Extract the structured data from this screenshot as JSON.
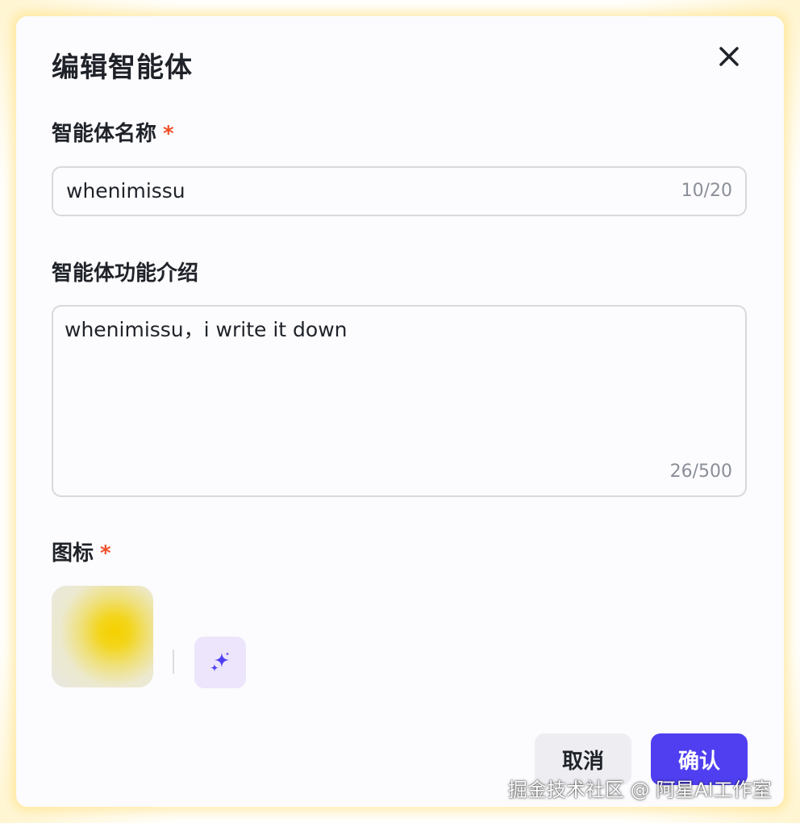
{
  "dialog": {
    "title": "编辑智能体",
    "close_icon": "close-icon"
  },
  "form": {
    "name": {
      "label": "智能体名称",
      "required_mark": "*",
      "value": "whenimissu",
      "counter": "10/20"
    },
    "description": {
      "label": "智能体功能介绍",
      "value": "whenimissu，i write it down",
      "counter": "26/500"
    },
    "icon": {
      "label": "图标",
      "required_mark": "*",
      "ai_generate_icon": "sparkle-icon"
    }
  },
  "footer": {
    "cancel_label": "取消",
    "confirm_label": "确认"
  },
  "watermark": "掘金技术社区 @ 阿星AI工作室",
  "colors": {
    "primary": "#4f3ff0",
    "required": "#f0502a",
    "dialog_bg": "#fcfbfd",
    "glow": "#ffdc6e"
  }
}
